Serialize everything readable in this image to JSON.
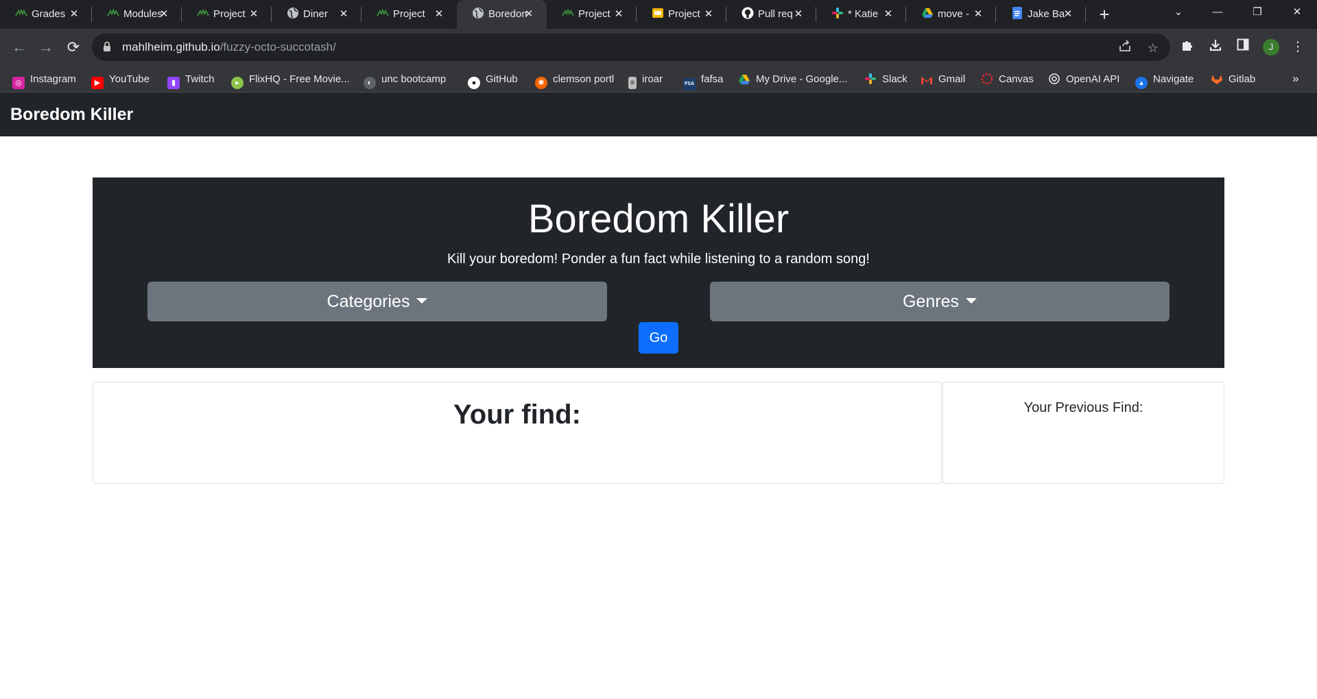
{
  "browser": {
    "tabs": [
      {
        "title": "Grades",
        "icon": "bootcamp-icon"
      },
      {
        "title": "Modules",
        "icon": "bootcamp-icon"
      },
      {
        "title": "Project",
        "icon": "bootcamp-icon"
      },
      {
        "title": "Diner",
        "icon": "globe-icon"
      },
      {
        "title": "Project",
        "icon": "bootcamp-icon"
      },
      {
        "title": "Boredom",
        "icon": "globe-icon",
        "active": true
      },
      {
        "title": "Project",
        "icon": "bootcamp-icon"
      },
      {
        "title": "Project",
        "icon": "slides-icon"
      },
      {
        "title": "Pull req",
        "icon": "github-icon"
      },
      {
        "title": "* Katie",
        "icon": "slack-icon"
      },
      {
        "title": "move -",
        "icon": "drive-icon"
      },
      {
        "title": "Jake Ba",
        "icon": "docs-icon"
      }
    ],
    "new_tab_label": "+",
    "address": {
      "host": "mahlheim.github.io",
      "path": "/fuzzy-octo-succotash/"
    },
    "profile_initial": "J",
    "bookmarks": [
      {
        "label": "Instagram",
        "icon": "instagram-icon",
        "color": "#d6249f"
      },
      {
        "label": "YouTube",
        "icon": "youtube-icon",
        "color": "#ff0000"
      },
      {
        "label": "Twitch",
        "icon": "twitch-icon",
        "color": "#9146ff"
      },
      {
        "label": "FlixHQ - Free Movie...",
        "icon": "flixhq-icon",
        "color": "#8bc34a"
      },
      {
        "label": "unc bootcamp",
        "icon": "globe-icon",
        "color": "#5f6368"
      },
      {
        "label": "GitHub",
        "icon": "github-icon",
        "color": "#202124"
      },
      {
        "label": "clemson portl",
        "icon": "paw-icon",
        "color": "#f56600"
      },
      {
        "label": "iroar",
        "icon": "doc-icon",
        "color": "#bdbdbd"
      },
      {
        "label": "fafsa",
        "icon": "fsa-icon",
        "color": "#1d3f6e"
      },
      {
        "label": "My Drive - Google...",
        "icon": "drive-icon",
        "color": "#1fa463"
      },
      {
        "label": "Slack",
        "icon": "slack-icon",
        "color": "#e01e5a"
      },
      {
        "label": "Gmail",
        "icon": "gmail-icon",
        "color": "#ea4335"
      },
      {
        "label": "Canvas",
        "icon": "canvas-icon",
        "color": "#e72429"
      },
      {
        "label": "OpenAI API",
        "icon": "openai-icon",
        "color": "#202124"
      },
      {
        "label": "Navigate",
        "icon": "navigate-icon",
        "color": "#1a73e8"
      },
      {
        "label": "Gitlab",
        "icon": "gitlab-icon",
        "color": "#fc6d26"
      }
    ]
  },
  "navbar": {
    "brand": "Boredom Killer"
  },
  "hero": {
    "title": "Boredom Killer",
    "lead": "Kill your boredom! Ponder a fun fact while listening to a random song!",
    "categories_label": "Categories",
    "genres_label": "Genres",
    "go_label": "Go"
  },
  "results": {
    "find_heading": "Your find:",
    "previous_heading": "Your Previous Find:"
  },
  "colors": {
    "dark": "#212529",
    "secondary": "#6c757d",
    "primary": "#0d6efd"
  }
}
